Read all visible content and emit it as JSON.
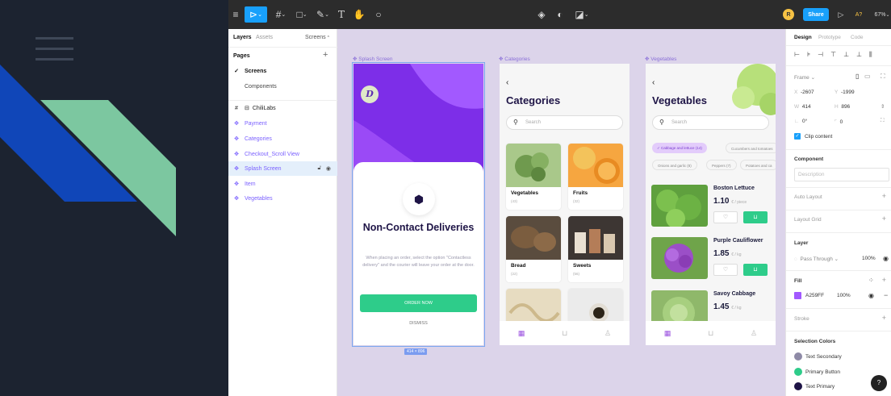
{
  "toolbar": {
    "share_label": "Share",
    "avatar_letter": "R",
    "a_label": "A?",
    "zoom": "67%"
  },
  "layers_panel": {
    "tab_layers": "Layers",
    "tab_assets": "Assets",
    "pages_dropdown": "Screens",
    "pages_title": "Pages",
    "pages": [
      "Screens",
      "Components"
    ],
    "section_title": "ChiliLabs",
    "items": [
      "Payment",
      "Categories",
      "Checkout_Scroll View",
      "Splash Screen",
      "Item",
      "Vegetables"
    ]
  },
  "canvas": {
    "frame_labels": [
      "Splash Screen",
      "Categories",
      "Vegetables"
    ],
    "size_badge": "414 × 896",
    "splash": {
      "logo_letter": "D",
      "title": "Non-Contact Deliveries",
      "body": "When placing an order, select the option \"Contactless delivery\" and the courier will leave your order at the door.",
      "button_label": "ORDER NOW",
      "dismiss_label": "DISMISS"
    },
    "categories": {
      "back": "‹",
      "title": "Categories",
      "search_placeholder": "Search",
      "cards": [
        {
          "name": "Vegetables",
          "count": "(43)"
        },
        {
          "name": "Fruits",
          "count": "(32)"
        },
        {
          "name": "Bread",
          "count": "(22)"
        },
        {
          "name": "Sweets",
          "count": "(56)"
        }
      ]
    },
    "vegetables": {
      "back": "‹",
      "title": "Vegetables",
      "search_placeholder": "Search",
      "chips": [
        "Cabbage and lettuce (14)",
        "Cucumbers and tomatoes",
        "Onions and garlic (8)",
        "Peppers (7)",
        "Potatoes and ca"
      ],
      "products": [
        {
          "name": "Boston Lettuce",
          "price": "1.10",
          "unit": "€ / piece"
        },
        {
          "name": "Purple Cauliflower",
          "price": "1.85",
          "unit": "€ / kg"
        },
        {
          "name": "Savoy Cabbage",
          "price": "1.45",
          "unit": "€ / kg"
        }
      ]
    }
  },
  "design_panel": {
    "tab_design": "Design",
    "tab_prototype": "Prototype",
    "tab_code": "Code",
    "frame_label": "Frame",
    "x_label": "X",
    "x_value": "-2607",
    "y_label": "Y",
    "y_value": "-1999",
    "w_label": "W",
    "w_value": "414",
    "h_label": "H",
    "h_value": "896",
    "rotation_value": "0°",
    "radius_value": "0",
    "clip_content": "Clip content",
    "component_title": "Component",
    "description_placeholder": "Description",
    "auto_layout": "Auto Layout",
    "layout_grid": "Layout Grid",
    "layer_title": "Layer",
    "blend_mode": "Pass Through",
    "layer_opacity": "100%",
    "fill_title": "Fill",
    "fill_hex": "A259FF",
    "fill_opacity": "100%",
    "stroke_title": "Stroke",
    "selection_colors_title": "Selection Colors",
    "selection_colors": [
      {
        "name": "Text Secondary",
        "color": "#8e8aa6"
      },
      {
        "name": "Primary Button",
        "color": "#2ecc8a"
      },
      {
        "name": "Text Primary",
        "color": "#1e1446"
      }
    ],
    "help": "?"
  },
  "colors": {
    "accent_blue": "#18a0fb",
    "purple": "#a259ff",
    "green": "#2ecc8a"
  }
}
